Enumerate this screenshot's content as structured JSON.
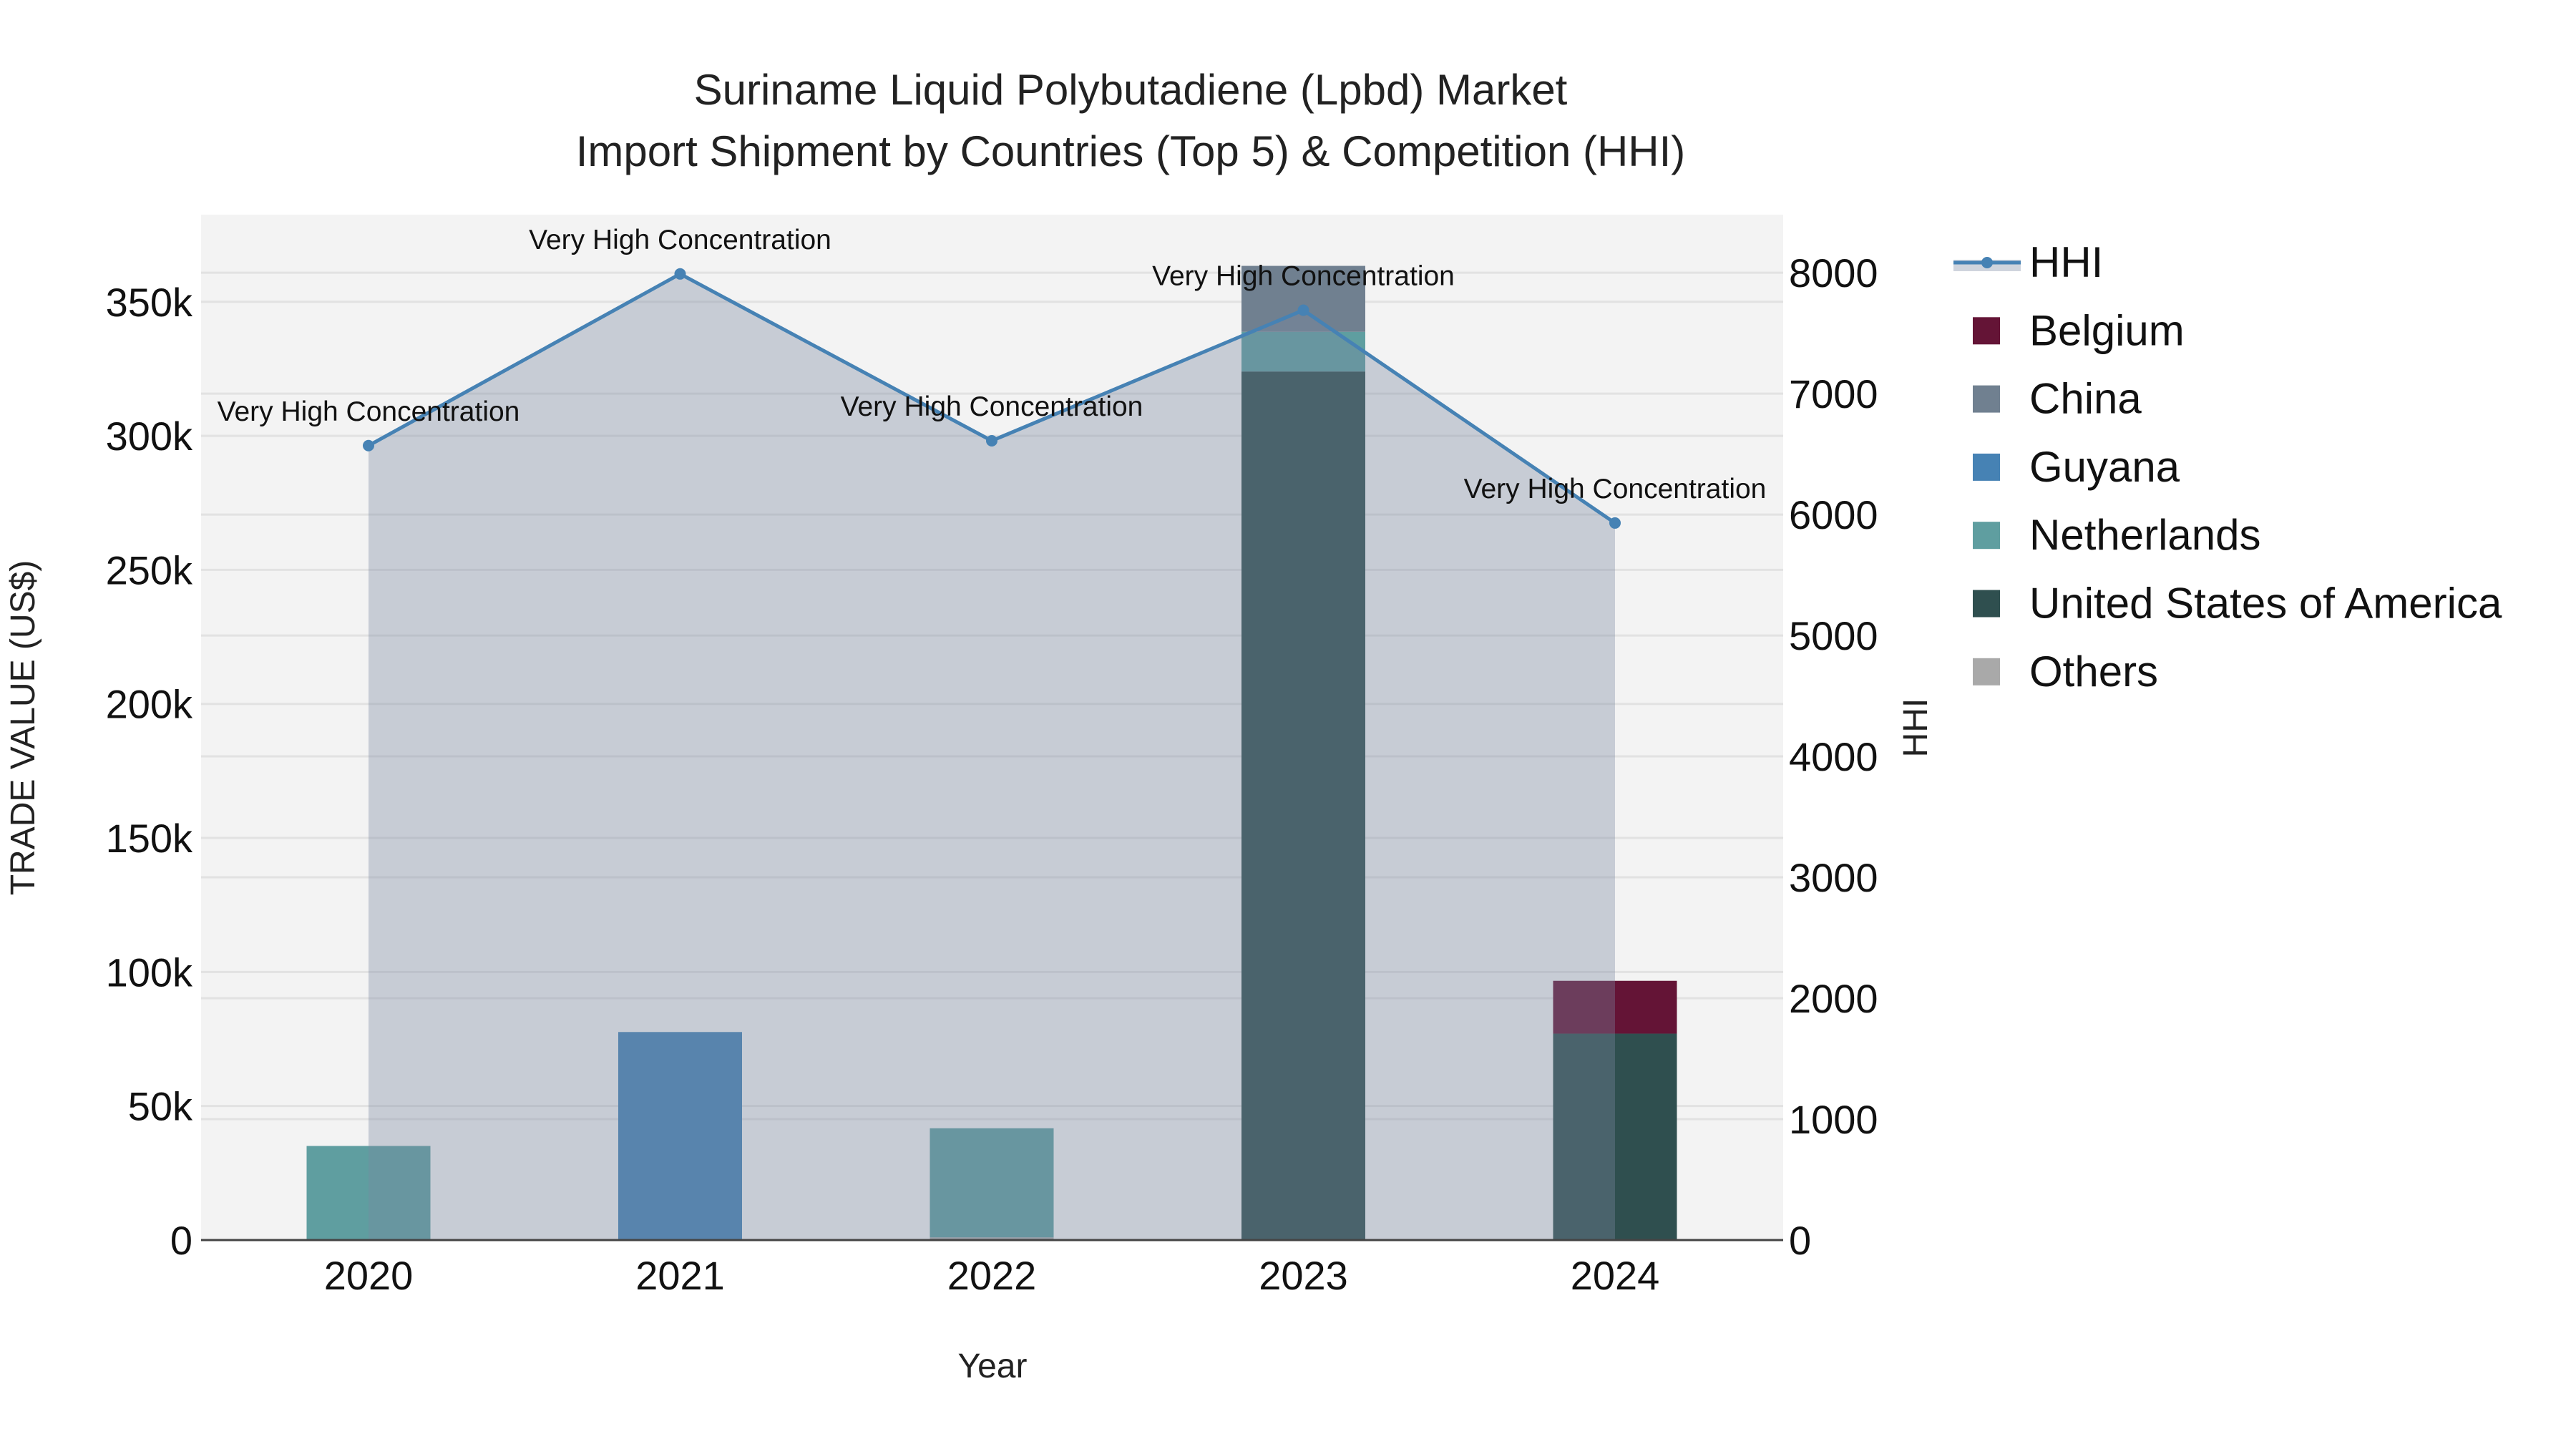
{
  "chart_data": {
    "type": "bar",
    "title": "Suriname Liquid Polybutadiene (Lpbd) Market",
    "subtitle": "Import Shipment by Countries (Top 5) & Competition (HHI)",
    "xlabel": "Year",
    "ylabel": "TRADE VALUE (US$)",
    "y2label": "HHI",
    "categories": [
      "2020",
      "2021",
      "2022",
      "2023",
      "2024"
    ],
    "ylim": [
      0,
      382500
    ],
    "y2lim": [
      0,
      8480
    ],
    "yticks": [
      0,
      50000,
      100000,
      150000,
      200000,
      250000,
      300000,
      350000
    ],
    "ytick_labels": [
      "0",
      "50k",
      "100k",
      "150k",
      "200k",
      "250k",
      "300k",
      "350k"
    ],
    "y2ticks": [
      0,
      1000,
      2000,
      3000,
      4000,
      5000,
      6000,
      7000,
      8000
    ],
    "y2tick_labels": [
      "0",
      "1000",
      "2000",
      "3000",
      "4000",
      "5000",
      "6000",
      "7000",
      "8000"
    ],
    "grid": true,
    "legend_position": "right",
    "series": [
      {
        "name": "Belgium",
        "color": "#641436",
        "values": [
          0,
          0,
          0,
          0,
          19700
        ]
      },
      {
        "name": "China",
        "color": "#708090",
        "values": [
          0,
          0,
          0,
          24600,
          0
        ]
      },
      {
        "name": "Guyana",
        "color": "#4682b4",
        "values": [
          0,
          77600,
          0,
          0,
          0
        ]
      },
      {
        "name": "Netherlands",
        "color": "#5f9ea0",
        "values": [
          35100,
          0,
          40700,
          14800,
          0
        ]
      },
      {
        "name": "United States of America",
        "color": "#2f4f4f",
        "values": [
          0,
          0,
          0,
          324000,
          77000
        ]
      },
      {
        "name": "Others",
        "color": "#a9a9a9",
        "values": [
          0,
          0,
          1000,
          0,
          0
        ]
      }
    ],
    "stack_order": [
      "Others",
      "United States of America",
      "Netherlands",
      "Guyana",
      "China",
      "Belgium"
    ],
    "hhi": {
      "name": "HHI",
      "color": "#4682b4",
      "values": [
        6570,
        7990,
        6610,
        7690,
        5930
      ],
      "annotations": [
        "Very High Concentration",
        "Very High Concentration",
        "Very High Concentration",
        "Very High Concentration",
        "Very High Concentration"
      ]
    },
    "legend_order": [
      "HHI",
      "Belgium",
      "China",
      "Guyana",
      "Netherlands",
      "United States of America",
      "Others"
    ]
  }
}
